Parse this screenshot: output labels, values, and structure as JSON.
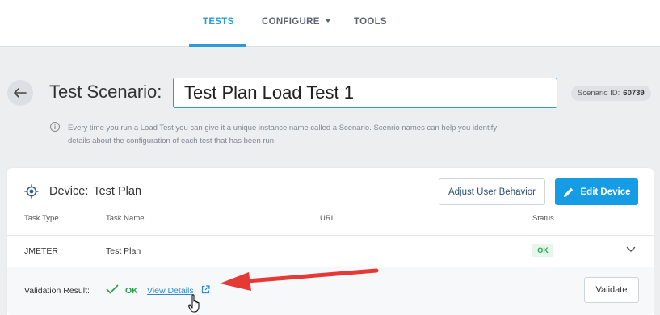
{
  "nav": {
    "tabs": [
      {
        "label": "TESTS",
        "active": true
      },
      {
        "label": "CONFIGURE",
        "dropdown": true
      },
      {
        "label": "TOOLS"
      }
    ],
    "accent_color": "#2b9bd8"
  },
  "header": {
    "back_icon": "arrow-left-icon",
    "scenario_label": "Test Scenario:",
    "scenario_name": "Test Plan Load Test 1",
    "scenario_id_label": "Scenario ID:",
    "scenario_id_value": "60739"
  },
  "info": {
    "icon": "info-icon",
    "text": "Every time you run a Load Test you can give it a unique instance name called a Scenario. Scenrio names can help you identify details about the configuration of each test that has been run."
  },
  "device": {
    "icon": "target-icon",
    "label": "Device:",
    "name": "Test Plan",
    "adjust_button": "Adjust User Behavior",
    "edit_button": "Edit Device",
    "edit_icon": "pencil-icon",
    "primary_color": "#159ce4"
  },
  "table": {
    "columns": [
      "Task Type",
      "Task Name",
      "URL",
      "Status"
    ],
    "rows": [
      {
        "task_type": "JMETER",
        "task_name": "Test Plan",
        "url": "",
        "status": "OK"
      }
    ],
    "expand_icon": "chevron-down-icon"
  },
  "validation": {
    "label": "Validation Result:",
    "status_icon": "check-icon",
    "status": "OK",
    "link_text": "View Details",
    "link_icon": "external-link-icon",
    "validate_button": "Validate"
  },
  "annotation": {
    "arrow_color": "#e53935"
  }
}
